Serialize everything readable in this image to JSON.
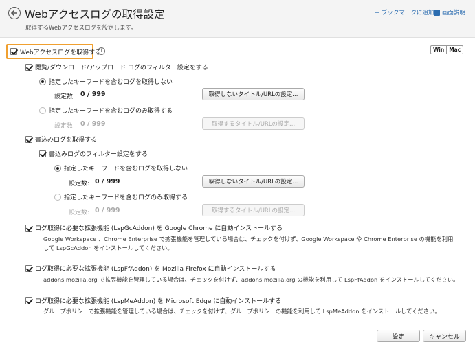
{
  "header": {
    "title": "Webアクセスログの取得設定",
    "subtitle": "取得するWebアクセスログを設定します。",
    "bookmark_link": "+ ブックマークに追加",
    "help_icon_glyph": "i",
    "help_link": "画面説明"
  },
  "os_toggle": {
    "win": "Win",
    "mac": "Mac"
  },
  "main_checkbox": {
    "label": "Webアクセスログを取得する",
    "checked": true
  },
  "info_glyph": "i",
  "browse_filter": {
    "label": "閲覧/ダウンロード/アップロード ログのフィルター設定をする",
    "checked": true
  },
  "browse_radio_exclude": {
    "label": "指定したキーワードを含むログを取得しない",
    "selected": true,
    "count_label": "設定数:",
    "count_value": "0 / 999",
    "button": "取得しないタイトル/URLの設定..."
  },
  "browse_radio_include": {
    "label": "指定したキーワードを含むログのみ取得する",
    "selected": false,
    "count_label": "設定数:",
    "count_value": "0 / 999",
    "button": "取得するタイトル/URLの設定..."
  },
  "write_log": {
    "label": "書込みログを取得する",
    "checked": true
  },
  "write_filter": {
    "label": "書込みログのフィルター設定をする",
    "checked": true
  },
  "write_radio_exclude": {
    "label": "指定したキーワードを含むログを取得しない",
    "selected": true,
    "count_label": "設定数:",
    "count_value": "0 / 999",
    "button": "取得しないタイトル/URLの設定..."
  },
  "write_radio_include": {
    "label": "指定したキーワードを含むログのみ取得する",
    "selected": false,
    "count_label": "設定数:",
    "count_value": "0 / 999",
    "button": "取得するタイトル/URLの設定..."
  },
  "chrome_addon": {
    "label": "ログ取得に必要な拡張機能 (LspGcAddon) を Google Chrome に自動インストールする",
    "checked": true,
    "desc_line1": "Google Workspace 、Chrome Enterprise で拡張機能を管理している場合は、チェックを付けず、Google Workspace や Chrome Enterprise の機能を利用",
    "desc_line2": "して LspGcAddon をインストールしてください。"
  },
  "firefox_addon": {
    "label": "ログ取得に必要な拡張機能 (LspFfAddon) を Mozilla Firefox に自動インストールする",
    "checked": true,
    "desc_line1": "addons.mozilla.org で拡張機能を管理している場合は、チェックを付けず、addons.mozilla.org の機能を利用して LspFfAddon をインストールしてください。"
  },
  "edge_addon": {
    "label": "ログ取得に必要な拡張機能 (LspMeAddon) を Microsoft Edge に自動インストールする",
    "checked": true,
    "desc_line1": "グループポリシーで拡張機能を管理している場合は、チェックを付けず、グループポリシーの機能を利用して LspMeAddon をインストールしてください。"
  },
  "footer": {
    "save": "設定",
    "cancel": "キャンセル"
  },
  "colors": {
    "accent": "#2b6cb0",
    "highlight": "#f0a030"
  }
}
